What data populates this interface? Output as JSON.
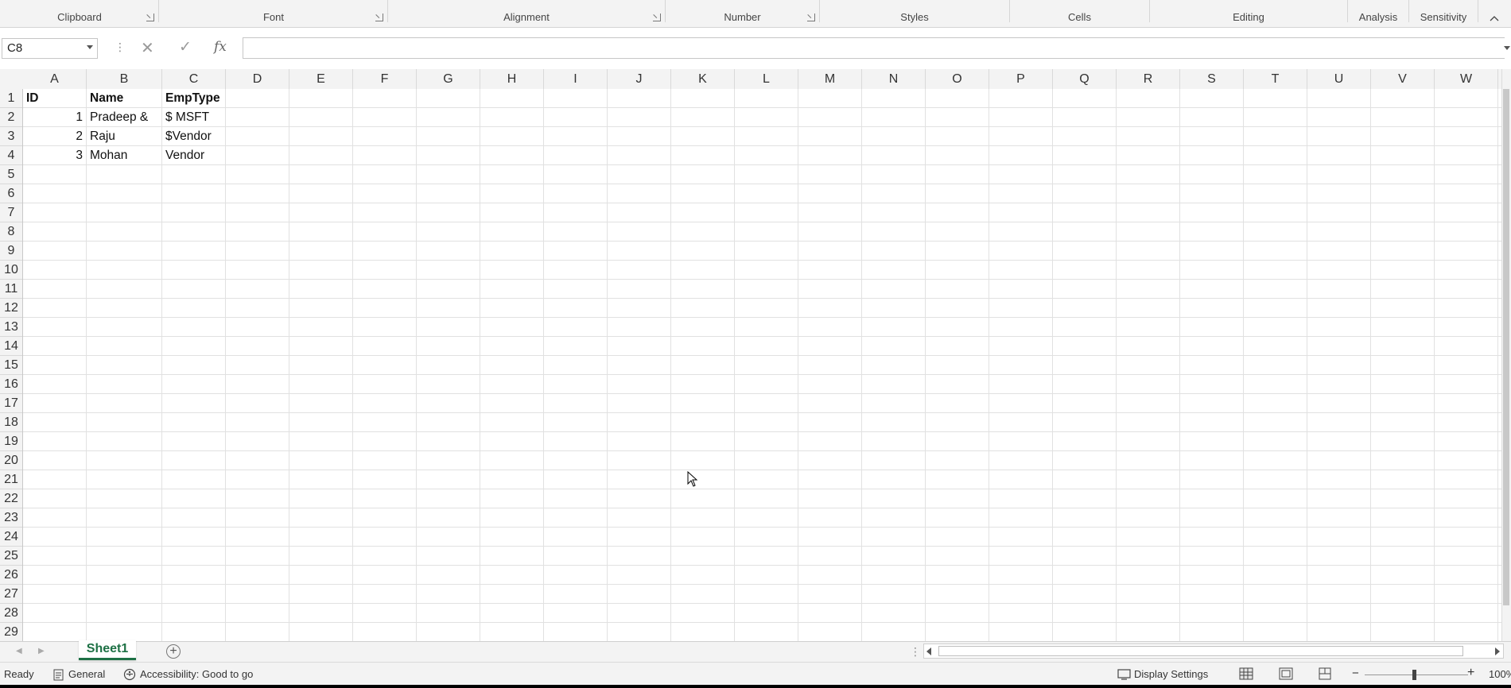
{
  "ribbon": {
    "groups": [
      "Clipboard",
      "Font",
      "Alignment",
      "Number",
      "Styles",
      "Cells",
      "Editing",
      "Analysis",
      "Sensitivity"
    ]
  },
  "formula_bar": {
    "name_box": "C8",
    "cancel_glyph": "✕",
    "enter_glyph": "✓",
    "fx_label": "fx",
    "formula": ""
  },
  "columns": [
    "A",
    "B",
    "C",
    "D",
    "E",
    "F",
    "G",
    "H",
    "I",
    "J",
    "K",
    "L",
    "M",
    "N",
    "O",
    "P",
    "Q",
    "R",
    "S",
    "T",
    "U",
    "V",
    "W"
  ],
  "rows": [
    "1",
    "2",
    "3",
    "4",
    "5",
    "6",
    "7",
    "8",
    "9",
    "10",
    "11",
    "12",
    "13",
    "14",
    "15",
    "16",
    "17",
    "18",
    "19",
    "20",
    "21",
    "22",
    "23",
    "24",
    "25",
    "26",
    "27",
    "28",
    "29"
  ],
  "cells": {
    "A1": "ID",
    "B1": "Name",
    "C1": "EmpType",
    "A2": "1",
    "B2": "Pradeep &",
    "C2": "$ MSFT",
    "A3": "2",
    "B3": "Raju",
    "C3": "$Vendor",
    "A4": "3",
    "B4": "Mohan",
    "C4": "Vendor"
  },
  "sheets": {
    "active": "Sheet1"
  },
  "status_bar": {
    "mode": "Ready",
    "format": "General",
    "accessibility": "Accessibility: Good to go",
    "display_settings": "Display Settings",
    "zoom": "100%"
  },
  "colors": {
    "accent": "#1e7145"
  }
}
